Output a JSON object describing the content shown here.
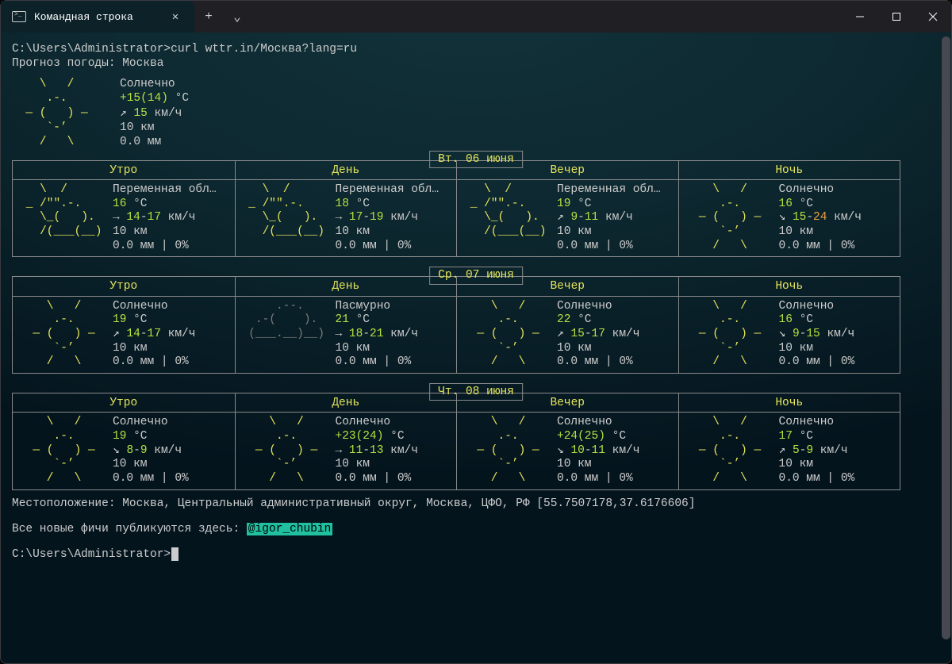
{
  "window": {
    "tab_title": "Командная строка",
    "new_tab_glyph": "+",
    "dropdown_glyph": "⌄",
    "close_glyph": "✕"
  },
  "prompt1": "C:\\Users\\Administrator>",
  "command": "curl wttr.in/Москва?lang=ru",
  "header_line": "Прогноз погоды: Москва",
  "current": {
    "ascii": "    \\   /\n     .-.\n  ― (   ) ―\n     `-’\n    /   \\",
    "cond": "Солнечно",
    "temp_main": "+15",
    "temp_feels": "(14)",
    "temp_unit": " °C",
    "wind_arrow": "↗",
    "wind_val": "15",
    "wind_unit": " км/ч",
    "vis": "10 км",
    "precip": "0.0 мм"
  },
  "day_parts": [
    "Утро",
    "День",
    "Вечер",
    "Ночь"
  ],
  "days": [
    {
      "date": "Вт. 06 июня",
      "cells": [
        {
          "ascii": "   \\  /\n _ /\"\".-.\n   \\_(   ).\n   /(___(__)",
          "cond": "Переменная обл…",
          "temp": "16",
          "temp_extra": "",
          "unit": " °C",
          "wind_arrow": "→",
          "wind_lo": "14",
          "wind_hi": "17",
          "wind_unit": " км/ч",
          "vis": "10 км",
          "precip": "0.0 мм | 0%"
        },
        {
          "ascii": "   \\  /\n _ /\"\".-.\n   \\_(   ).\n   /(___(__)",
          "cond": "Переменная обл…",
          "temp": "18",
          "temp_extra": "",
          "unit": " °C",
          "wind_arrow": "→",
          "wind_lo": "17",
          "wind_hi": "19",
          "wind_unit": " км/ч",
          "vis": "10 км",
          "precip": "0.0 мм | 0%"
        },
        {
          "ascii": "   \\  /\n _ /\"\".-.\n   \\_(   ).\n   /(___(__)",
          "cond": "Переменная обл…",
          "temp": "19",
          "temp_extra": "",
          "unit": " °C",
          "wind_arrow": "↗",
          "wind_lo": "9",
          "wind_hi": "11",
          "wind_unit": " км/ч",
          "vis": "10 км",
          "precip": "0.0 мм | 0%"
        },
        {
          "ascii": "    \\   /\n     .-.\n  ― (   ) ―\n     `-’\n    /   \\",
          "cond": "Солнечно",
          "temp": "16",
          "temp_extra": "",
          "unit": " °C",
          "wind_arrow": "↘",
          "wind_lo": "15",
          "wind_hi": "24",
          "wind_unit": " км/ч",
          "vis": "10 км",
          "precip": "0.0 мм | 0%",
          "hi_orange": true
        }
      ]
    },
    {
      "date": "Ср. 07 июня",
      "cells": [
        {
          "ascii": "    \\   /\n     .-.\n  ― (   ) ―\n     `-’\n    /   \\",
          "cond": "Солнечно",
          "temp": "19",
          "temp_extra": "",
          "unit": " °C",
          "wind_arrow": "↗",
          "wind_lo": "14",
          "wind_hi": "17",
          "wind_unit": " км/ч",
          "vis": "10 км",
          "precip": "0.0 мм | 0%"
        },
        {
          "ascii": "     .--.\n  .-(    ).\n (___.__)__)\n            ",
          "cond": "Пасмурно",
          "temp": "21",
          "temp_extra": "",
          "unit": " °C",
          "wind_arrow": "→",
          "wind_lo": "18",
          "wind_hi": "21",
          "wind_unit": " км/ч",
          "vis": "10 км",
          "precip": "0.0 мм | 0%",
          "ascii_grey": true
        },
        {
          "ascii": "    \\   /\n     .-.\n  ― (   ) ―\n     `-’\n    /   \\",
          "cond": "Солнечно",
          "temp": "22",
          "temp_extra": "",
          "unit": " °C",
          "wind_arrow": "↗",
          "wind_lo": "15",
          "wind_hi": "17",
          "wind_unit": " км/ч",
          "vis": "10 км",
          "precip": "0.0 мм | 0%"
        },
        {
          "ascii": "    \\   /\n     .-.\n  ― (   ) ―\n     `-’\n    /   \\",
          "cond": "Солнечно",
          "temp": "16",
          "temp_extra": "",
          "unit": " °C",
          "wind_arrow": "↘",
          "wind_lo": "9",
          "wind_hi": "15",
          "wind_unit": " км/ч",
          "vis": "10 км",
          "precip": "0.0 мм | 0%"
        }
      ]
    },
    {
      "date": "Чт. 08 июня",
      "cells": [
        {
          "ascii": "    \\   /\n     .-.\n  ― (   ) ―\n     `-’\n    /   \\",
          "cond": "Солнечно",
          "temp": "19",
          "temp_extra": "",
          "unit": " °C",
          "wind_arrow": "↘",
          "wind_lo": "8",
          "wind_hi": "9",
          "wind_unit": " км/ч",
          "vis": "10 км",
          "precip": "0.0 мм | 0%"
        },
        {
          "ascii": "    \\   /\n     .-.\n  ― (   ) ―\n     `-’\n    /   \\",
          "cond": "Солнечно",
          "temp": "+23",
          "temp_extra": "(24)",
          "unit": " °C",
          "wind_arrow": "→",
          "wind_lo": "11",
          "wind_hi": "13",
          "wind_unit": " км/ч",
          "vis": "10 км",
          "precip": "0.0 мм | 0%"
        },
        {
          "ascii": "    \\   /\n     .-.\n  ― (   ) ―\n     `-’\n    /   \\",
          "cond": "Солнечно",
          "temp": "+24",
          "temp_extra": "(25)",
          "unit": " °C",
          "wind_arrow": "↘",
          "wind_lo": "10",
          "wind_hi": "11",
          "wind_unit": " км/ч",
          "vis": "10 км",
          "precip": "0.0 мм | 0%"
        },
        {
          "ascii": "    \\   /\n     .-.\n  ― (   ) ―\n     `-’\n    /   \\",
          "cond": "Солнечно",
          "temp": "17",
          "temp_extra": "",
          "unit": " °C",
          "wind_arrow": "↗",
          "wind_lo": "5",
          "wind_hi": "9",
          "wind_unit": " км/ч",
          "vis": "10 км",
          "precip": "0.0 мм | 0%"
        }
      ]
    }
  ],
  "location_line": "Местоположение: Москва, Центральный административный округ, Москва, ЦФО, РФ [55.7507178,37.6176606]",
  "news_prefix": "Все новые фичи публикуются здесь: ",
  "news_handle": "@igor_chubin",
  "prompt2": "C:\\Users\\Administrator>"
}
